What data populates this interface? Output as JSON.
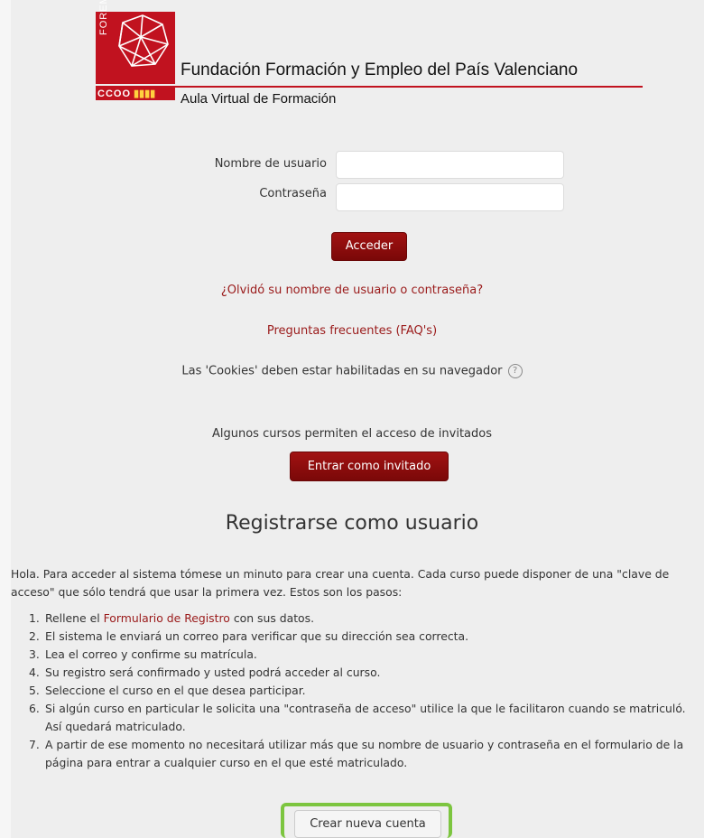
{
  "header": {
    "logo_vertical_text": "FOREM PV",
    "logo_ccoo_text": "CCOO",
    "org_title": "Fundación Formación y Empleo del País Valenciano",
    "org_subtitle": "Aula Virtual de Formación"
  },
  "login": {
    "username_label": "Nombre de usuario",
    "username_value": "",
    "password_label": "Contraseña",
    "password_value": "",
    "submit_label": "Acceder",
    "forgot_link": "¿Olvidó su nombre de usuario o contraseña?",
    "faq_link": "Preguntas frecuentes (FAQ's)",
    "cookies_note": "Las 'Cookies' deben estar habilitadas en su navegador"
  },
  "guest": {
    "note": "Algunos cursos permiten el acceso de invitados",
    "button_label": "Entrar como invitado"
  },
  "signup": {
    "title": "Registrarse como usuario",
    "intro": "Hola. Para acceder al sistema tómese un minuto para crear una cuenta. Cada curso puede disponer de una \"clave de acceso\" que sólo tendrá que usar la primera vez. Estos son los pasos:",
    "steps": [
      {
        "num": "1.",
        "pre": "Rellene el ",
        "link": "Formulario de Registro",
        "post": " con sus datos."
      },
      {
        "num": "2.",
        "text": "El sistema le enviará un correo para verificar que su dirección sea correcta."
      },
      {
        "num": "3.",
        "text": "Lea el correo y confirme su matrícula."
      },
      {
        "num": "4.",
        "text": "Su registro será confirmado y usted podrá acceder al curso."
      },
      {
        "num": "5.",
        "text": "Seleccione el curso en el que desea participar."
      },
      {
        "num": "6.",
        "text": "Si algún curso en particular le solicita una \"contraseña de acceso\" utilice la que le facilitaron cuando se matriculó. Así quedará matriculado."
      },
      {
        "num": "7.",
        "text": "A partir de ese momento no necesitará utilizar más que su nombre de usuario y contraseña en el formulario de la página para entrar a cualquier curso en el que esté matriculado."
      }
    ],
    "create_button_label": "Crear nueva cuenta"
  },
  "colors": {
    "brand_red": "#c1121f",
    "button_red": "#8b0c0c",
    "link_red": "#9a1a1a",
    "highlight_green": "#7cc53f"
  },
  "icons": {
    "help": "question-circle-icon",
    "logo": "network-logo-icon"
  }
}
